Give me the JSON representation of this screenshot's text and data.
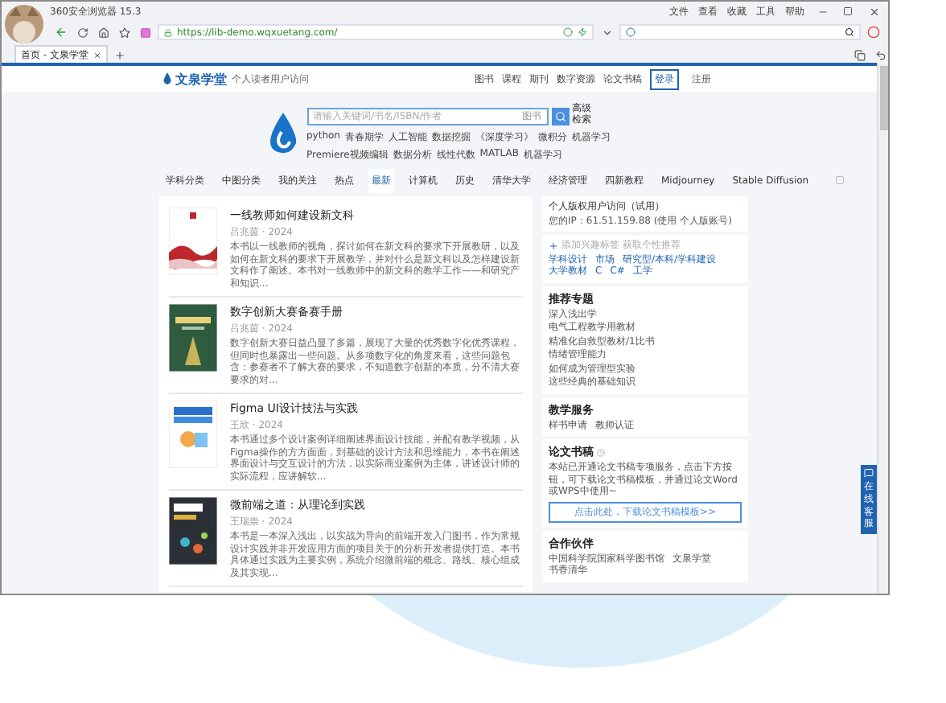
{
  "browser": {
    "title": "360安全浏览器 15.3",
    "menu": [
      "文件",
      "查看",
      "收藏",
      "工具",
      "帮助"
    ],
    "url": "https://lib-demo.wqxuetang.com/",
    "tabs": [
      {
        "label": "首页 - 文泉学堂",
        "selected": true
      }
    ]
  },
  "site": {
    "logo": "文泉学堂",
    "tagline": "个人读者用户访问",
    "nav": [
      "图书",
      "课程",
      "期刊",
      "数字资源",
      "论文书稿"
    ],
    "account": [
      {
        "label": "登录",
        "selected": true
      },
      {
        "label": "注册",
        "selected": false
      }
    ]
  },
  "search": {
    "placeholder": "请输入关键词/书名/ISBN/作者",
    "scope": "图书",
    "advanced": "高级检索",
    "hot_terms": [
      [
        "python",
        "青春期学",
        "人工智能",
        "数据挖掘",
        "《深度学习》",
        "微积分",
        "机器学习"
      ],
      [
        "Premiere视频编辑",
        "数据分析",
        "线性代数",
        "MATLAB",
        "机器学习"
      ]
    ]
  },
  "categories": [
    {
      "label": "学科分类",
      "selected": false
    },
    {
      "label": "中图分类",
      "selected": false
    },
    {
      "label": "我的关注",
      "selected": false
    },
    {
      "label": "热点",
      "selected": false
    },
    {
      "label": "最新",
      "selected": true
    },
    {
      "label": "计算机",
      "selected": false
    },
    {
      "label": "历史",
      "selected": false
    },
    {
      "label": "清华大学",
      "selected": false
    },
    {
      "label": "经济管理",
      "selected": false
    },
    {
      "label": "四新教程",
      "selected": false
    },
    {
      "label": "Midjourney",
      "selected": false
    },
    {
      "label": "Stable Diffusion",
      "selected": false
    }
  ],
  "books": [
    {
      "title": "一线教师如何建设新文科",
      "meta": "吕兆茵 · 2024",
      "description": "本书以一线教师的视角，探讨如何在新文科的要求下开展教研，以及如何在新文科的要求下开展教学，并对什么是新文科以及怎样建设新文科作了阐述。本书对一线教师中的新文科的教学工作——和研究产和知识..."
    },
    {
      "title": "数字创新大赛备赛手册",
      "meta": "吕兆茵 · 2024",
      "description": "数字创新大赛日益凸显了多篇，展现了大量的优秀数字化优秀课程，但同时也暴露出一些问题。从多项数字化的角度来看，这些问题包含：参赛者不了解大赛的要求，不知道数字创新的本质，分不清大赛要求的对..."
    },
    {
      "title": "Figma UI设计技法与实践",
      "meta": "王欣 · 2024",
      "description": "本书通过多个设计案例详细阐述界面设计技能，并配有教学视频，从Figma操作的方方面面，到基础的设计方法和思维能力，本书在阐述界面设计与交互设计的方法，以实际商业案例为主体，讲述设计师的实际流程，应讲解软..."
    },
    {
      "title": "微前端之道：从理论到实践",
      "meta": "王瑞崇 · 2024",
      "description": "本书是一本深入浅出，以实战为导向的前端开发入门图书，作为常规设计实践并非开发应用方面的项目关于的分析开发者提供打造。本书具体通过实践为主要实例，系统介绍微前端的概念、路线、核心组成及其实现..."
    }
  ],
  "sidebar": {
    "access": {
      "title": "个人版权用户访问（试用）",
      "ip": "您的IP：61.51.159.88 (使用 个人版账号)"
    },
    "interests": {
      "add": "添加兴趣标签 获取个性推荐",
      "tags": [
        "学科设计",
        "市场",
        "研究型/本科/学科建设",
        "大学教材",
        "C",
        "C#",
        "工学"
      ]
    },
    "topics": {
      "title": "推荐专题",
      "items": [
        "深入浅出学",
        "电气工程教学用教材",
        "精准化自救型教材/1比书",
        "情绪管理能力",
        "如何成为管理型实验",
        "这些经典的基础知识"
      ]
    },
    "service": {
      "title": "教学服务",
      "links": [
        "样书申请",
        "教师认证"
      ]
    },
    "thesis": {
      "title": "论文书稿",
      "text": "本站已开通论文书稿专项服务，点击下方按钮，可下载论文书稿模板，并通过论文Word或WPS中使用~",
      "button": "点击此处，下载论文书稿模板>>"
    },
    "partners": {
      "title": "合作伙伴",
      "items": [
        "中国科学院国家科学图书馆",
        "文泉学堂",
        "书香清华"
      ]
    }
  },
  "float_widget": {
    "label": "在线客服"
  }
}
